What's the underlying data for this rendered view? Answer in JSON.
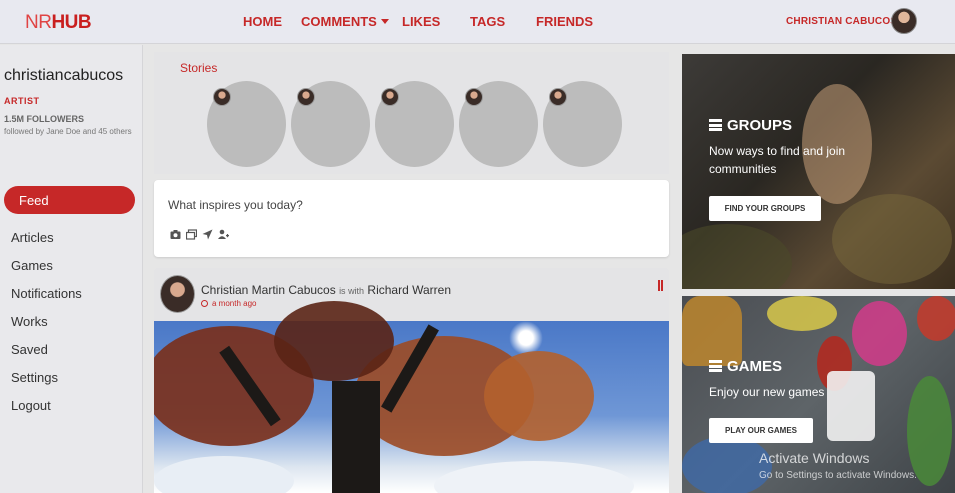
{
  "brand": {
    "logo_prefix": "NR",
    "logo_suffix": "HUB"
  },
  "nav": {
    "links": [
      "HOME",
      "COMMENTS",
      "LIKES",
      "TAGS",
      "FRIENDS"
    ],
    "user_name": "CHRISTIAN CABUCOS"
  },
  "profile": {
    "username": "christiancabucos",
    "role": "ARTIST",
    "followers": "1.5M FOLLOWERS",
    "followed_by": "followed by Jane Doe and 45 others"
  },
  "sidebar": {
    "active": "Feed",
    "items": [
      "Articles",
      "Games",
      "Notifications",
      "Works",
      "Saved",
      "Settings",
      "Logout"
    ]
  },
  "stories": {
    "title": "Stories"
  },
  "composer": {
    "prompt": "What inspires you today?",
    "icons": [
      "camera-icon",
      "images-icon",
      "location-arrow-icon",
      "tag-people-icon"
    ]
  },
  "post": {
    "author": "Christian Martin Cabucos",
    "with_text": "is with",
    "tagged": "Richard Warren",
    "time": "a month ago"
  },
  "cards": {
    "groups": {
      "title": "GROUPS",
      "text": "Now ways to find and join communities",
      "button": "FIND YOUR GROUPS"
    },
    "games": {
      "title": "GAMES",
      "text": "Enjoy our new games",
      "button": "PLAY OUR GAMES"
    }
  },
  "watermark": {
    "title": "Activate Windows",
    "subtitle": "Go to Settings to activate Windows."
  },
  "colors": {
    "accent": "#c62828",
    "nav_bg": "#e8e9f0"
  }
}
